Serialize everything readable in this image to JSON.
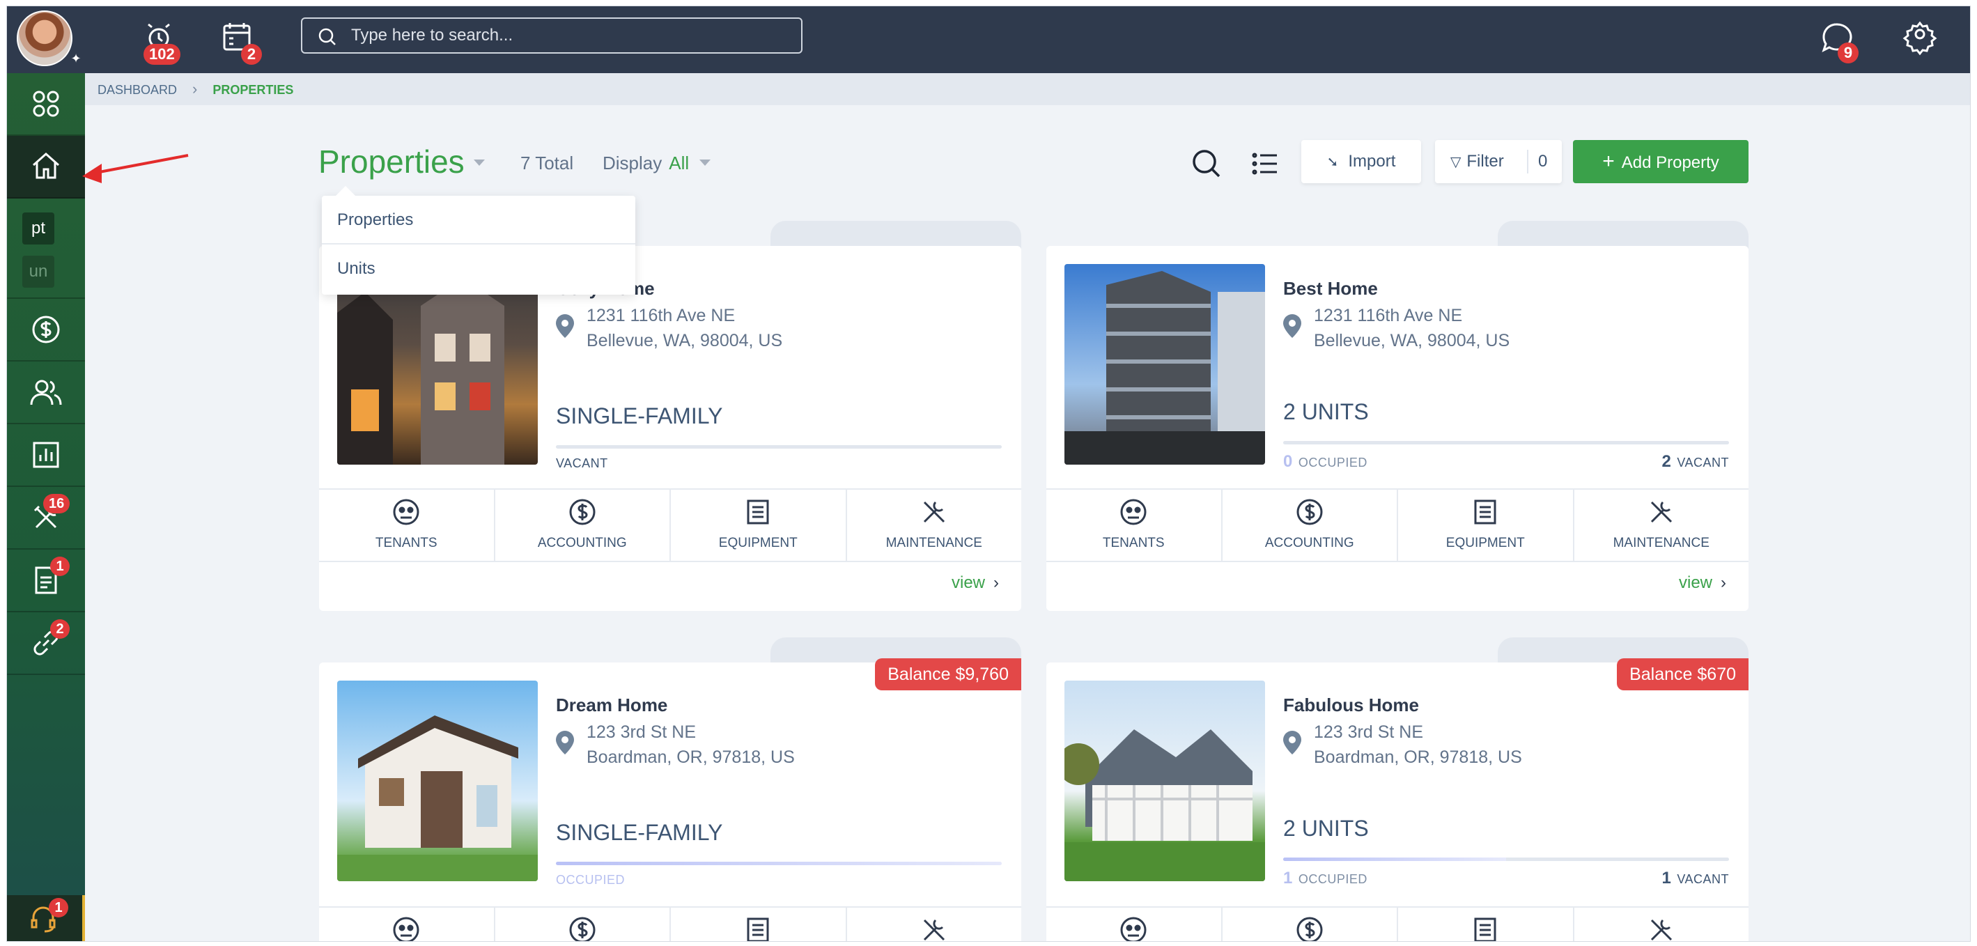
{
  "topbar": {
    "alarm_badge": "102",
    "calendar_badge": "2",
    "search_placeholder": "Type here to search...",
    "chat_badge": "9"
  },
  "sidebar": {
    "chip_pt": "pt",
    "chip_un": "un",
    "maintenance_badge": "16",
    "documents_badge": "1",
    "links_badge": "2",
    "support_badge": "1"
  },
  "breadcrumb": {
    "items": [
      "DASHBOARD",
      "PROPERTIES"
    ]
  },
  "header": {
    "title": "Properties",
    "total": "7 Total",
    "display_label": "Display",
    "display_value": "All",
    "import_label": "Import",
    "filter_label": "Filter",
    "filter_count": "0",
    "add_label": "Add Property"
  },
  "dropdown": {
    "items": [
      "Properties",
      "Units"
    ]
  },
  "grid_labels": [
    "TENANTS",
    "ACCOUNTING",
    "EQUIPMENT",
    "MAINTENANCE"
  ],
  "view_label": "view",
  "cards": [
    {
      "name": "Cozy Home",
      "addr1": "1231 116th Ave NE",
      "addr2": "Bellevue, WA, 98004, US",
      "type": "SINGLE-FAMILY",
      "status": "VACANT"
    },
    {
      "name": "Best Home",
      "addr1": "1231 116th Ave NE",
      "addr2": "Bellevue, WA, 98004, US",
      "type": "2 UNITS",
      "occupied": "0",
      "occupied_label": "OCCUPIED",
      "vacant": "2",
      "vacant_label": "VACANT"
    },
    {
      "name": "Dream Home",
      "addr1": "123 3rd St NE",
      "addr2": "Boardman, OR, 97818, US",
      "type": "SINGLE-FAMILY",
      "status": "OCCUPIED",
      "balance": "Balance $9,760"
    },
    {
      "name": "Fabulous Home",
      "addr1": "123 3rd St NE",
      "addr2": "Boardman, OR, 97818, US",
      "type": "2 UNITS",
      "occupied": "1",
      "occupied_label": "OCCUPIED",
      "vacant": "1",
      "vacant_label": "VACANT",
      "balance": "Balance $670",
      "occupied_fraction": 0.5
    }
  ],
  "colors": {
    "brand_green": "#3aa14a",
    "topbar": "#2f3a4d",
    "badge_red": "#e03a3a",
    "balance_red": "#e34848"
  }
}
